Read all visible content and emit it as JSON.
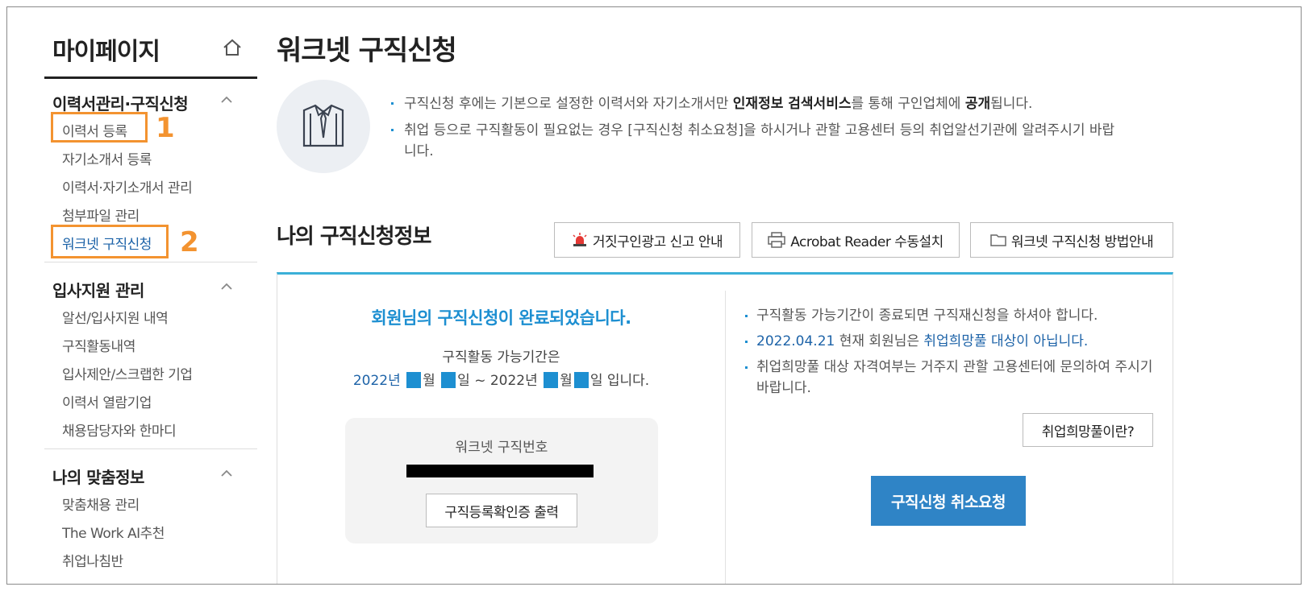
{
  "sidebar": {
    "title": "마이페이지",
    "home_icon": "home-icon",
    "sections": [
      {
        "title": "이력서관리·구직신청",
        "items": [
          {
            "label": "이력서 등록"
          },
          {
            "label": "자기소개서 등록"
          },
          {
            "label": "이력서·자기소개서 관리"
          },
          {
            "label": "첨부파일 관리"
          },
          {
            "label": "워크넷 구직신청",
            "active": true
          }
        ]
      },
      {
        "title": "입사지원 관리",
        "items": [
          {
            "label": "알선/입사지원 내역"
          },
          {
            "label": "구직활동내역"
          },
          {
            "label": "입사제안/스크랩한 기업"
          },
          {
            "label": "이력서 열람기업"
          },
          {
            "label": "채용담당자와 한마디"
          }
        ]
      },
      {
        "title": "나의 맞춤정보",
        "items": [
          {
            "label": "맞춤채용 관리"
          },
          {
            "label": "The Work AI추천"
          },
          {
            "label": "취업나침반"
          }
        ]
      }
    ]
  },
  "annotations": {
    "step1": "1",
    "step2": "2",
    "color": "#f39330"
  },
  "main": {
    "title": "워크넷 구직신청",
    "notice1": {
      "pre": "구직신청 후에는 기본으로 설정한 이력서와 자기소개서만 ",
      "bold1": "인재정보 검색서비스",
      "mid": "를 통해 구인업체에 ",
      "bold2": "공개",
      "post": "됩니다."
    },
    "notice2_line1": "취업 등으로 구직활동이 필요없는 경우 [구직신청 취소요청]을 하시거나 관할 고용센터 등의 취업알선기관에 알려주시기 바랍",
    "notice2_line2": "니다.",
    "section_title": "나의 구직신청정보",
    "buttons": {
      "fake_ad": "거짓구인광고 신고 안내",
      "acrobat": "Acrobat Reader 수동설치",
      "guide": "워크넷 구직신청 방법안내"
    },
    "left": {
      "done_msg": "회원님의 구직신청이 완료되었습니다.",
      "period_label": "구직활동 가능기간은",
      "period": {
        "y1": "2022년 ",
        "m": "월 ",
        "d": "일 ~ 2022년 ",
        "m2": "월",
        "d2": "일 입니다."
      },
      "number_label": "워크넷 구직번호",
      "print_button": "구직등록확인증 출력"
    },
    "right": {
      "info1": "구직활동 가능기간이 종료되면 구직재신청을 하셔야 합니다.",
      "info2_date": "2022.04.21",
      "info2_mid": " 현재 회원님은 ",
      "info2_blue": "취업희망풀 대상이 아닙니다.",
      "info3": "취업희망풀 대상 자격여부는 거주지 관할 고용센터에 문의하여 주시기 바랍니다.",
      "hope_button": "취업희망풀이란?",
      "cancel_button": "구직신청 취소요청"
    }
  },
  "colors": {
    "accent_blue": "#1d8fd1",
    "link_blue": "#1d63a8",
    "cancel_button": "#2f84c6",
    "panel_top": "#3bb0d8"
  }
}
